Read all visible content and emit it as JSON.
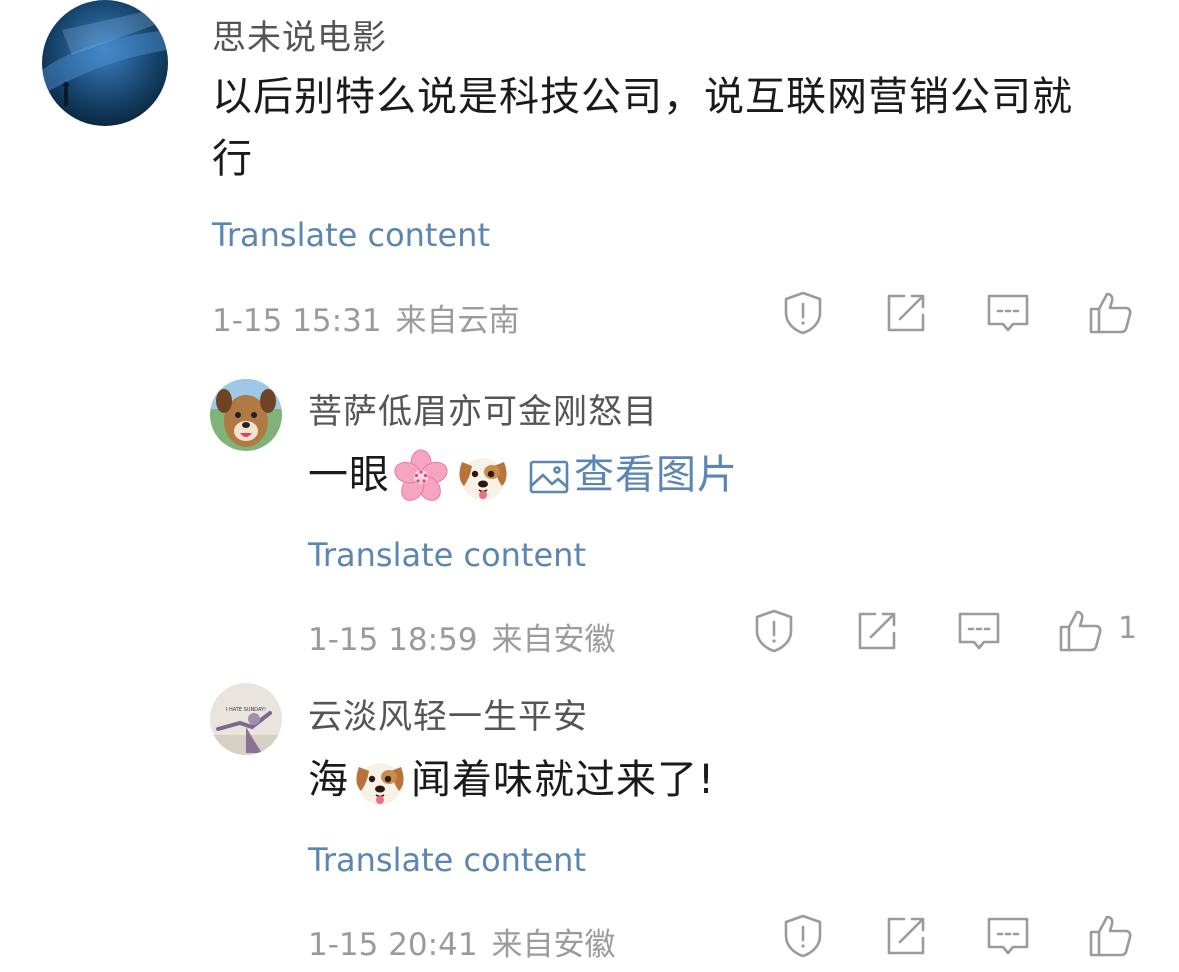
{
  "comments": [
    {
      "username": "思未说电影",
      "text": "以后别特么说是科技公司，说互联网营销公司就行",
      "translate": "Translate content",
      "date": "1-15 15:31",
      "location": "来自云南",
      "like_count": ""
    },
    {
      "username": "菩萨低眉亦可金刚怒目",
      "text_prefix": "一眼",
      "emojis": [
        "cherry-blossom-emoji",
        "dog-face-emoji"
      ],
      "image_link": "查看图片",
      "translate": "Translate content",
      "date": "1-15 18:59",
      "location": "来自安徽",
      "like_count": "1"
    },
    {
      "username": "云淡风轻一生平安",
      "text_prefix": "海",
      "emojis": [
        "dog-face-emoji"
      ],
      "text_suffix": "闻着味就过来了!",
      "avatar_text": "I HATE SUNDAY!",
      "translate": "Translate content",
      "date": "1-15 20:41",
      "location": "来自安徽",
      "like_count": ""
    }
  ],
  "icons": {
    "report": "shield-exclamation-icon",
    "repost": "share-edit-icon",
    "reply": "comment-icon",
    "like": "thumbs-up-icon"
  },
  "colors": {
    "link": "#5b86b3",
    "meta": "#9b9b9b",
    "username": "#555555",
    "text": "#1a1a1a"
  }
}
